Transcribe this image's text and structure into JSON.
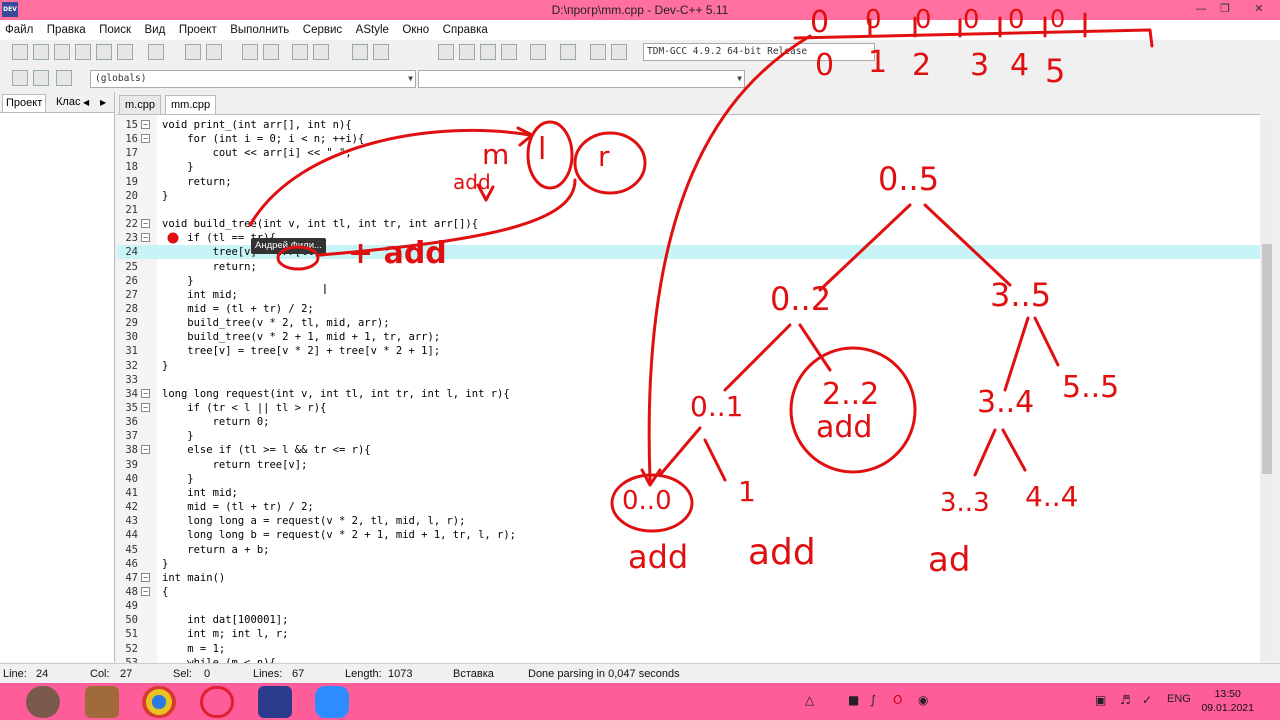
{
  "window": {
    "title": "D:\\прогр\\mm.cpp - Dev-C++ 5.11",
    "app_icon": "DEV"
  },
  "menu": [
    "Файл",
    "Правка",
    "Поиск",
    "Вид",
    "Проект",
    "Выполнить",
    "Сервис",
    "AStyle",
    "Окно",
    "Справка"
  ],
  "toolbar": {
    "compiler": "TDM-GCC 4.9.2 64-bit Release"
  },
  "scope_combo": {
    "value": "(globals)"
  },
  "side_tabs": [
    "Проект",
    "Клас"
  ],
  "file_tabs": [
    "m.cpp",
    "mm.cpp"
  ],
  "editor": {
    "lines": [
      {
        "n": "15",
        "code": "void print_(int arr[], int n){"
      },
      {
        "n": "16",
        "code": "    for (int i = 0; i < n; ++i){"
      },
      {
        "n": "17",
        "code": "        cout << arr[i] << \" \";"
      },
      {
        "n": "18",
        "code": "    }"
      },
      {
        "n": "19",
        "code": "    return;"
      },
      {
        "n": "20",
        "code": "}"
      },
      {
        "n": "21",
        "code": ""
      },
      {
        "n": "22",
        "code": "void build_tree(int v, int tl, int tr, int arr[]){"
      },
      {
        "n": "23",
        "code": "    if (tl == tr){"
      },
      {
        "n": "24",
        "code": "        tree[v] = arr[tl];"
      },
      {
        "n": "25",
        "code": "        return;"
      },
      {
        "n": "26",
        "code": "    }"
      },
      {
        "n": "27",
        "code": "    int mid;"
      },
      {
        "n": "28",
        "code": "    mid = (tl + tr) / 2;"
      },
      {
        "n": "29",
        "code": "    build_tree(v * 2, tl, mid, arr);"
      },
      {
        "n": "30",
        "code": "    build_tree(v * 2 + 1, mid + 1, tr, arr);"
      },
      {
        "n": "31",
        "code": "    tree[v] = tree[v * 2] + tree[v * 2 + 1];"
      },
      {
        "n": "32",
        "code": "}"
      },
      {
        "n": "33",
        "code": ""
      },
      {
        "n": "34",
        "code": "long long request(int v, int tl, int tr, int l, int r){"
      },
      {
        "n": "35",
        "code": "    if (tr < l || tl > r){"
      },
      {
        "n": "36",
        "code": "        return 0;"
      },
      {
        "n": "37",
        "code": "    }"
      },
      {
        "n": "38",
        "code": "    else if (tl >= l && tr <= r){"
      },
      {
        "n": "39",
        "code": "        return tree[v];"
      },
      {
        "n": "40",
        "code": "    }"
      },
      {
        "n": "41",
        "code": "    int mid;"
      },
      {
        "n": "42",
        "code": "    mid = (tl + tr) / 2;"
      },
      {
        "n": "43",
        "code": "    long long a = request(v * 2, tl, mid, l, r);"
      },
      {
        "n": "44",
        "code": "    long long b = request(v * 2 + 1, mid + 1, tr, l, r);"
      },
      {
        "n": "45",
        "code": "    return a + b;"
      },
      {
        "n": "46",
        "code": "}"
      },
      {
        "n": "47",
        "code": "int main()"
      },
      {
        "n": "48",
        "code": "{"
      },
      {
        "n": "49",
        "code": ""
      },
      {
        "n": "50",
        "code": "    int dat[100001];"
      },
      {
        "n": "51",
        "code": "    int m; int l, r;"
      },
      {
        "n": "52",
        "code": "    m = 1;"
      },
      {
        "n": "53",
        "code": "    while (m < n){"
      }
    ],
    "highlight_line": "24",
    "tooltip": "Андрей Фили..."
  },
  "status": {
    "line_label": "Line:",
    "line_val": "24",
    "col_label": "Col:",
    "col_val": "27",
    "sel_label": "Sel:",
    "sel_val": "0",
    "lines_label": "Lines:",
    "lines_val": "67",
    "length_label": "Length:",
    "length_val": "1073",
    "mode": "Вставка",
    "message": "Done parsing in 0,047 seconds"
  },
  "taskbar": {
    "lang": "ENG",
    "time": "13:50",
    "date": "09.01.2021"
  },
  "annotations": {
    "top_array": [
      "0",
      "0",
      "0",
      "0",
      "0",
      "0"
    ],
    "top_indices": [
      "0",
      "1",
      "2",
      "3",
      "4",
      "5"
    ],
    "labels": [
      "m",
      "l",
      "r",
      "add",
      "+ add"
    ],
    "tree_nodes": [
      "0..5",
      "0..2",
      "3..5",
      "0..1",
      "2..2",
      "3..4",
      "5..5",
      "0..0",
      "1",
      "3..3",
      "4..4"
    ],
    "add_labels": [
      "add",
      "add",
      "add",
      "ad"
    ],
    "ink_color": "#e01010"
  }
}
